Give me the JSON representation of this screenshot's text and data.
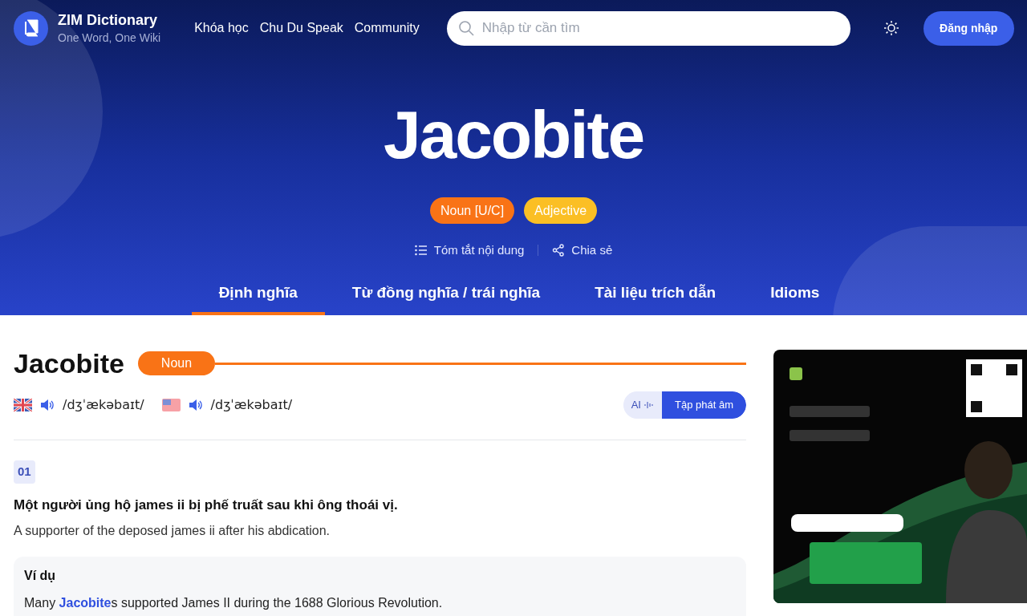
{
  "brand": {
    "name": "ZIM Dictionary",
    "tagline": "One Word, One Wiki"
  },
  "nav": [
    "Khóa học",
    "Chu Du Speak",
    "Community"
  ],
  "search": {
    "placeholder": "Nhập từ cần tìm"
  },
  "login": "Đăng nhập",
  "word": "Jacobite",
  "pos_badges": [
    {
      "label": "Noun [U/C]",
      "color": "#f97316"
    },
    {
      "label": "Adjective",
      "color": "#fbbf24"
    }
  ],
  "actions": [
    {
      "kind": "summary",
      "label": "Tóm tắt nội dung"
    },
    {
      "kind": "share",
      "label": "Chia sẻ"
    }
  ],
  "tabs": [
    {
      "label": "Định nghĩa",
      "selected": true
    },
    {
      "label": "Từ đồng nghĩa / trái nghĩa",
      "selected": false
    },
    {
      "label": "Tài liệu trích dẫn",
      "selected": false
    },
    {
      "label": "Idioms",
      "selected": false
    }
  ],
  "entry": {
    "word": "Jacobite",
    "pos": "Noun",
    "pronunciations": [
      {
        "kind": "uk",
        "ipa": "/dʒˈækəbaɪt/"
      },
      {
        "kind": "us",
        "ipa": "/dʒˈækəbaɪt/"
      }
    ],
    "practice": {
      "ai": "AI",
      "label": "Tập phát âm"
    },
    "senses": [
      {
        "number": "01",
        "vi": "Một người ủng hộ james ii bị phế truất sau khi ông thoái vị.",
        "en": "A supporter of the deposed james ii after his abdication.",
        "example_title": "Ví dụ",
        "example": "Many **Jacobite**s supported James II during the 1688 Glorious Revolution."
      }
    ]
  },
  "ad": {
    "kind": "picture"
  }
}
